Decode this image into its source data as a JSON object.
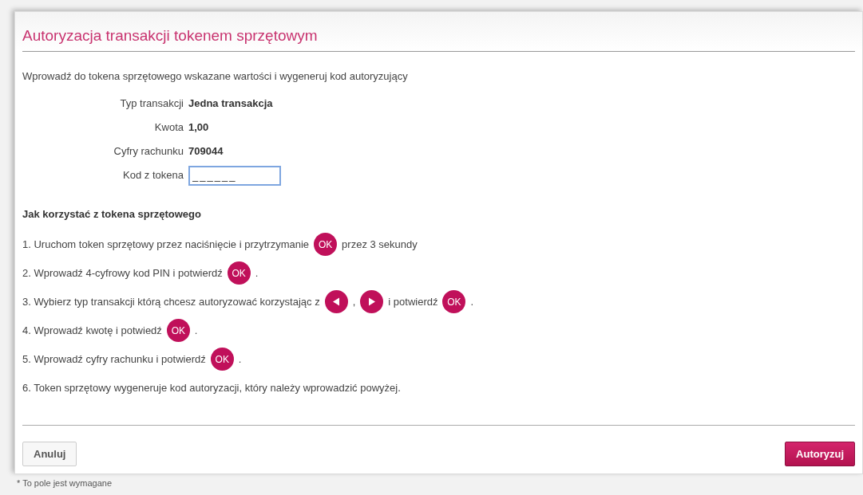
{
  "title": "Autoryzacja transakcji tokenem sprzętowym",
  "intro": "Wprowadź do tokena sprzętowego wskazane wartości i wygeneruj kod autoryzujący",
  "fields": [
    {
      "kind": "static",
      "label": "Typ transakcji",
      "value": "Jedna transakcja"
    },
    {
      "kind": "static",
      "label": "Kwota",
      "value": "1,00"
    },
    {
      "kind": "static",
      "label": "Cyfry rachunku",
      "value": "709044"
    },
    {
      "kind": "input",
      "label": "Kod z tokena",
      "value": "______",
      "focused": true
    }
  ],
  "instructions_heading": "Jak korzystać z tokena sprzętowego",
  "steps": [
    [
      {
        "kind": "text",
        "text": "1. Uruchom token sprzętowy przez naciśnięcie i przytrzymanie"
      },
      {
        "kind": "ok",
        "text": "OK"
      },
      {
        "kind": "text",
        "text": "przez 3 sekundy"
      }
    ],
    [
      {
        "kind": "text",
        "text": "2. Wprowadź 4-cyfrowy kod PIN i potwierdź"
      },
      {
        "kind": "ok",
        "text": "OK"
      },
      {
        "kind": "text",
        "text": "."
      }
    ],
    [
      {
        "kind": "text",
        "text": "3. Wybierz typ transakcji którą chcesz autoryzować korzystając z"
      },
      {
        "kind": "left"
      },
      {
        "kind": "text",
        "text": ","
      },
      {
        "kind": "right"
      },
      {
        "kind": "text",
        "text": "i potwierdź"
      },
      {
        "kind": "ok",
        "text": "OK"
      },
      {
        "kind": "text",
        "text": "."
      }
    ],
    [
      {
        "kind": "text",
        "text": "4. Wprowadź kwotę i potwiedź"
      },
      {
        "kind": "ok",
        "text": "OK"
      },
      {
        "kind": "text",
        "text": "."
      }
    ],
    [
      {
        "kind": "text",
        "text": "5. Wprowadź cyfry rachunku i potwierdź"
      },
      {
        "kind": "ok",
        "text": "OK"
      },
      {
        "kind": "text",
        "text": "."
      }
    ],
    [
      {
        "kind": "text",
        "text": "6. Token sprzętowy wygeneruje kod autoryzacji, który należy wprowadzić powyżej."
      }
    ]
  ],
  "buttons": {
    "cancel": "Anuluj",
    "confirm": "Autoryzuj"
  },
  "footnote": "* To pole jest wymagane"
}
